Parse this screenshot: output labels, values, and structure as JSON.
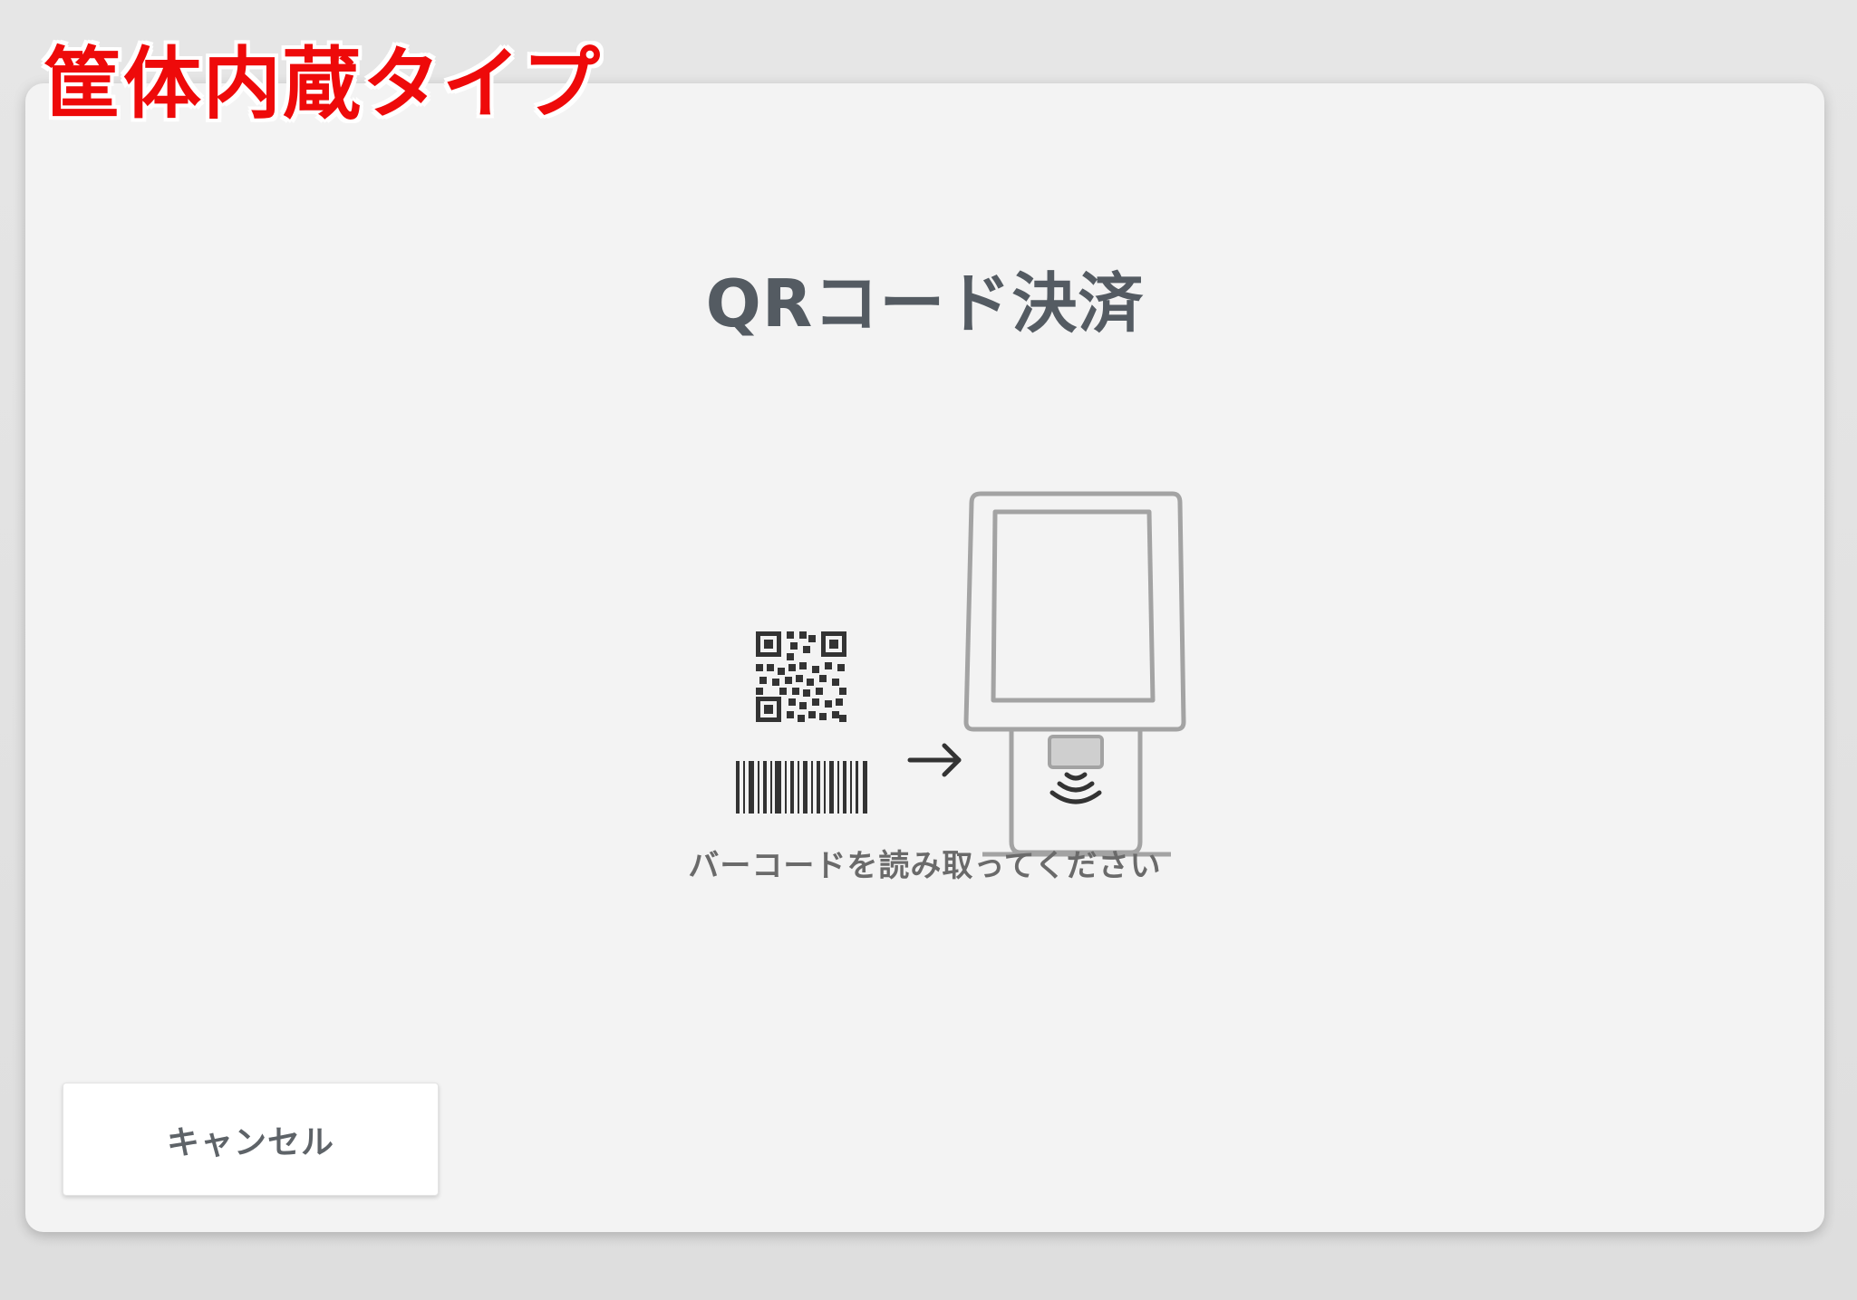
{
  "annotation": {
    "label": "筐体内蔵タイプ",
    "color": "#ee0a0a"
  },
  "screen": {
    "title": "QRコード決済",
    "instruction": "バーコードを読み取ってください",
    "illustration": {
      "icons": [
        "qr-code-icon",
        "barcode-icon",
        "arrow-right-icon",
        "kiosk-terminal-icon",
        "contactless-reader-icon"
      ]
    }
  },
  "actions": {
    "cancel_label": "キャンセル"
  },
  "colors": {
    "title": "#545b62",
    "card_background": "#f3f3f3",
    "button_background": "#ffffff"
  }
}
